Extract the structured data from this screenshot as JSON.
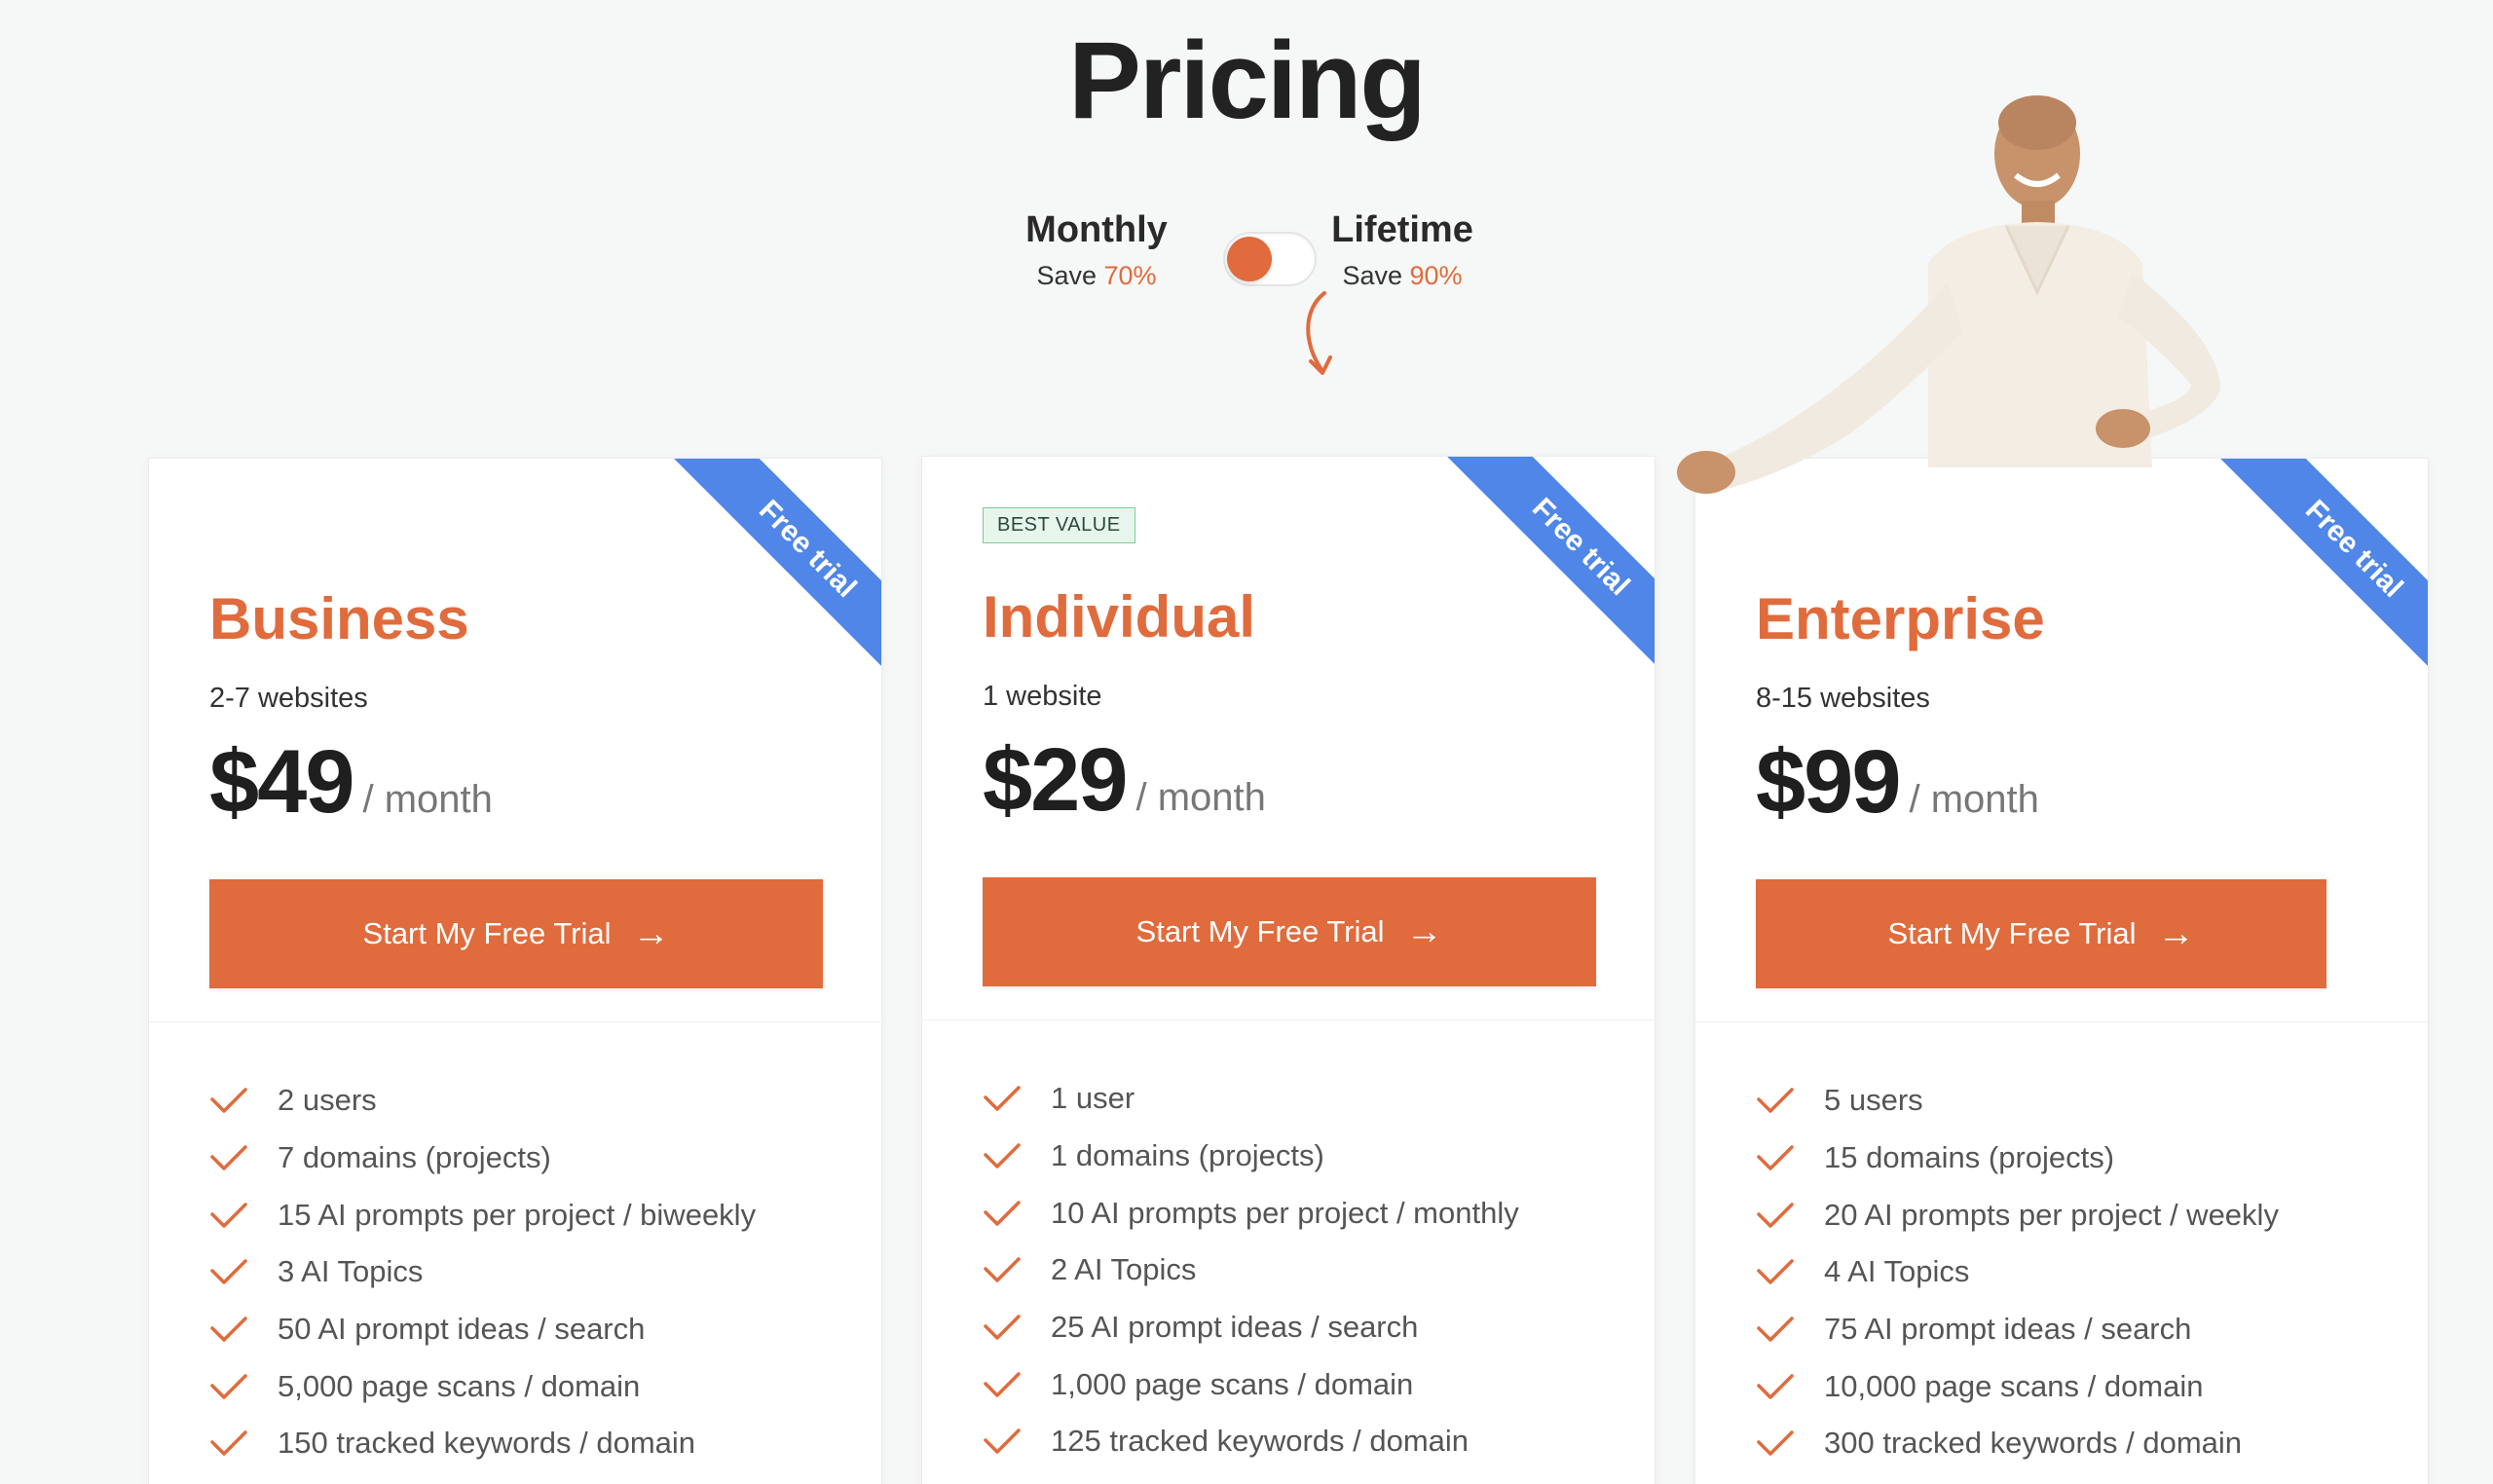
{
  "page": {
    "title": "Pricing"
  },
  "billing": {
    "monthly": {
      "label": "Monthly",
      "save_prefix": "Save",
      "save_pct": "70%"
    },
    "lifetime": {
      "label": "Lifetime",
      "save_prefix": "Save",
      "save_pct": "90%"
    },
    "selected": "Monthly"
  },
  "colors": {
    "accent": "#e06b3c",
    "ribbon": "#4f86e8",
    "badge_bg": "#e6f6ec"
  },
  "plans": [
    {
      "name": "Business",
      "ribbon": "Free trial",
      "sites": "2-7 websites",
      "price": "$49",
      "period": "/ month",
      "cta": "Start My Free Trial",
      "features": [
        "2 users",
        "7 domains (projects)",
        "15 AI prompts per project / biweekly",
        "3 AI Topics",
        "50 AI prompt ideas / search",
        "5,000 page scans / domain",
        "150 tracked keywords / domain"
      ]
    },
    {
      "name": "Individual",
      "badge": "BEST VALUE",
      "ribbon": "Free trial",
      "sites": "1 website",
      "price": "$29",
      "period": "/ month",
      "cta": "Start My Free Trial",
      "features": [
        "1 user",
        "1 domains (projects)",
        "10 AI prompts per project / monthly",
        "2 AI Topics",
        "25 AI prompt ideas / search",
        "1,000 page scans / domain",
        "125 tracked keywords / domain"
      ]
    },
    {
      "name": "Enterprise",
      "ribbon": "Free trial",
      "sites": "8-15 websites",
      "price": "$99",
      "period": "/ month",
      "cta": "Start My Free Trial",
      "features": [
        "5 users",
        "15 domains (projects)",
        "20 AI prompts per project / weekly",
        "4 AI Topics",
        "75 AI prompt ideas / search",
        "10,000 page scans / domain",
        "300 tracked keywords / domain"
      ]
    }
  ]
}
